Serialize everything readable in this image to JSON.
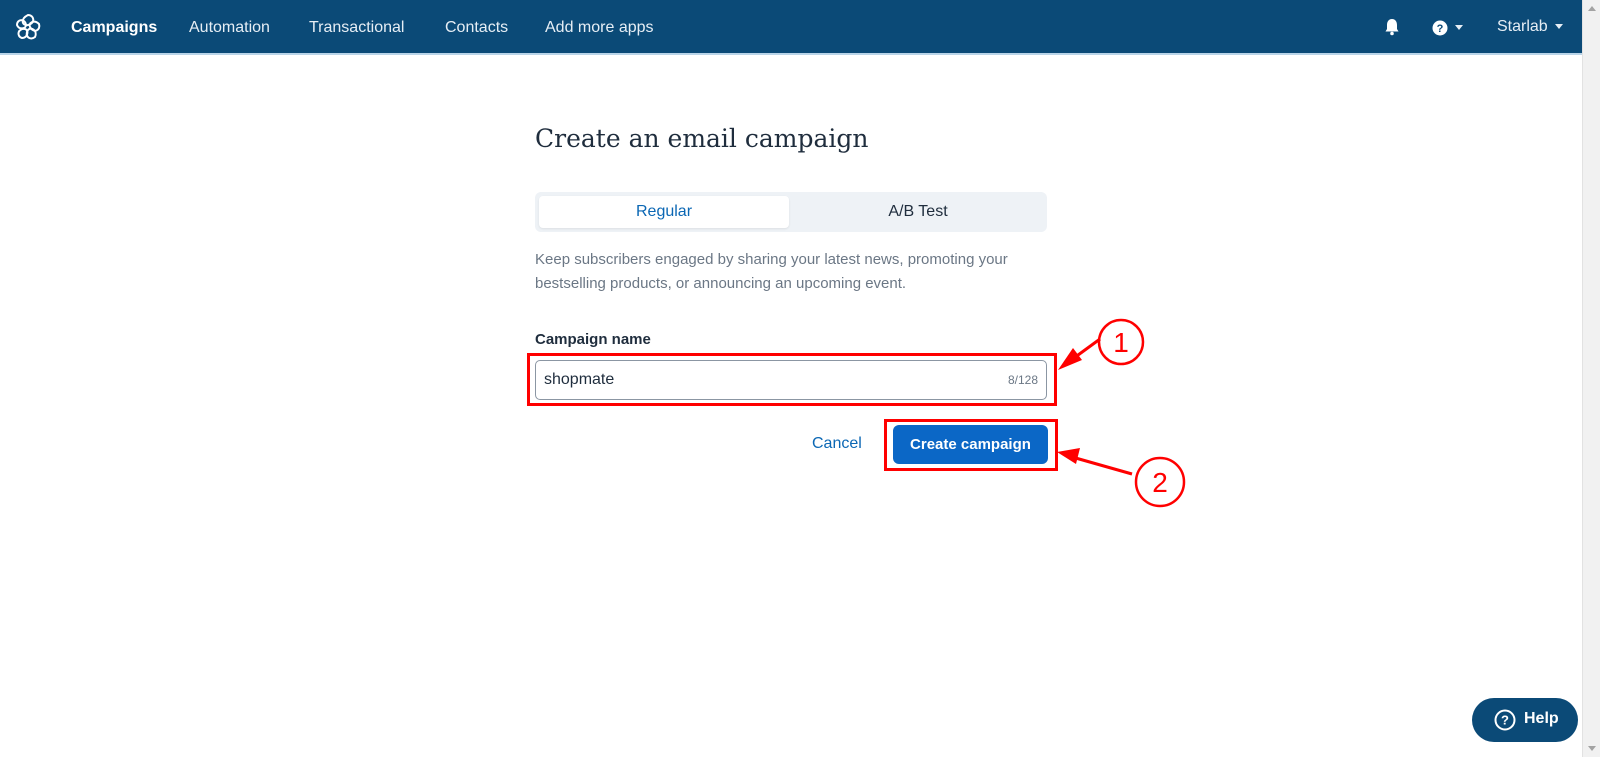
{
  "navbar": {
    "items": [
      {
        "label": "Campaigns",
        "active": true
      },
      {
        "label": "Automation"
      },
      {
        "label": "Transactional"
      },
      {
        "label": "Contacts"
      },
      {
        "label": "Add more apps"
      }
    ],
    "account_name": "Starlab",
    "bell_icon": "bell-icon",
    "help_icon": "question-circle-icon",
    "logo_icon": "sendinblue-logo"
  },
  "main": {
    "title": "Create an email campaign",
    "tabs": [
      {
        "label": "Regular",
        "selected": true
      },
      {
        "label": "A/B Test",
        "selected": false
      }
    ],
    "description": "Keep subscribers engaged by sharing your latest news, promoting your bestselling products, or announcing an upcoming event.",
    "campaign_name_label": "Campaign name",
    "campaign_name_value": "shopmate",
    "char_counter": "8/128",
    "cancel_label": "Cancel",
    "create_label": "Create campaign"
  },
  "annotations": {
    "step1": "1",
    "step2": "2"
  },
  "help_widget": {
    "label": "Help"
  },
  "colors": {
    "navbar_bg": "#0b4a77",
    "primary": "#0b67c6",
    "annotation": "#ff0000"
  }
}
